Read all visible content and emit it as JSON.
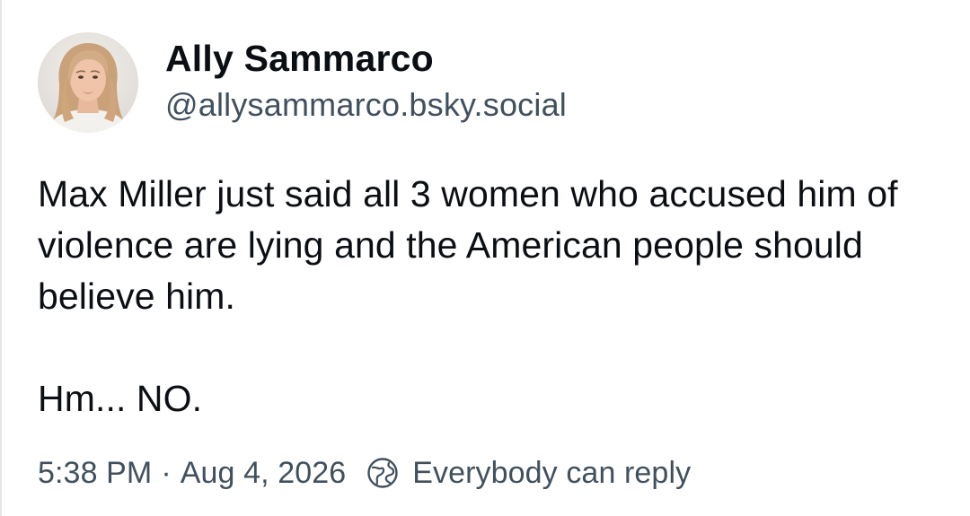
{
  "post": {
    "author": {
      "display_name": "Ally Sammarco",
      "handle": "@allysammarco.bsky.social",
      "avatar_icon": "profile-photo"
    },
    "text": {
      "paragraph_1": "Max Miller just said all 3 women who accused him of violence are lying and the American people should believe him.",
      "paragraph_2": "Hm... NO."
    },
    "meta": {
      "time": "5:38 PM",
      "separator": "·",
      "date": "Aug 4, 2026",
      "reply_icon": "globe-icon",
      "reply_setting": "Everybody can reply"
    }
  },
  "colors": {
    "text_primary": "#0b0f14",
    "text_secondary": "#41505e",
    "background": "#ffffff"
  }
}
